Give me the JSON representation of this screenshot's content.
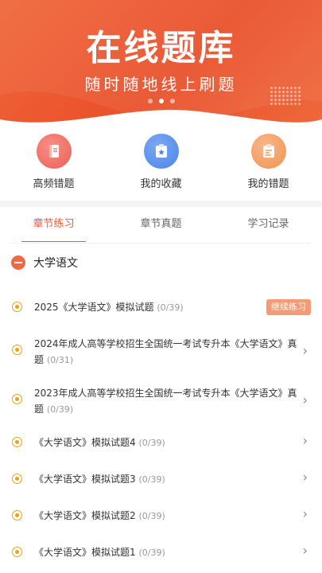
{
  "banner": {
    "title": "在线题库",
    "subtitle": "随时随地线上刷题"
  },
  "quick_actions": [
    {
      "label": "高频错题",
      "icon": "notebook-icon"
    },
    {
      "label": "我的收藏",
      "icon": "star-clipboard-icon"
    },
    {
      "label": "我的错题",
      "icon": "error-clipboard-icon"
    }
  ],
  "tabs": [
    {
      "label": "章节练习",
      "active": true
    },
    {
      "label": "章节真题",
      "active": false
    },
    {
      "label": "学习记录",
      "active": false
    }
  ],
  "section": {
    "label": "大学语文"
  },
  "items": [
    {
      "line1": "2025《大学语文》模拟试题",
      "line2": "",
      "count": "(0/39)",
      "action": "继续练习"
    },
    {
      "line1": "2024年成人高等学校招生全国统一考试专升本《大学语文》真",
      "line2": "题",
      "count": "(0/31)"
    },
    {
      "line1": "2023年成人高等学校招生全国统一考试专升本《大学语文》真",
      "line2": "题",
      "count": "(0/39)"
    },
    {
      "line1": "《大学语文》模拟试题4",
      "line2": "",
      "count": "(0/39)"
    },
    {
      "line1": "《大学语文》模拟试题3",
      "line2": "",
      "count": "(0/39)"
    },
    {
      "line1": "《大学语文》模拟试题2",
      "line2": "",
      "count": "(0/39)"
    },
    {
      "line1": "《大学语文》模拟试题1",
      "line2": "",
      "count": "(0/39)"
    }
  ],
  "colors": {
    "accent": "#ea5a2e",
    "radio": "#f0a400"
  }
}
